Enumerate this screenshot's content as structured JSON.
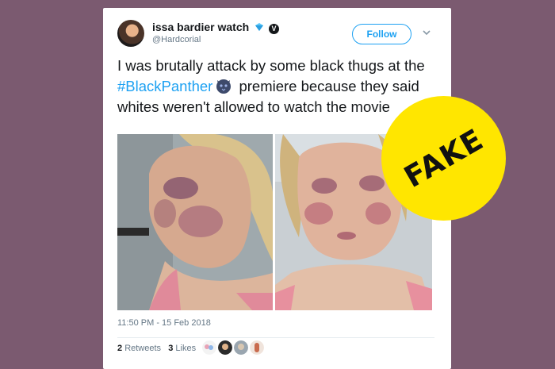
{
  "tweet": {
    "display_name": "issa bardier watch",
    "handle": "@Hardcorial",
    "follow_label": "Follow",
    "text_before_hashtag": "I was brutally attack by some black thugs at the ",
    "hashtag": "#BlackPanther",
    "text_after_hashtag": " premiere because they said whites weren't allowed to watch the movie",
    "timestamp": "11:50 PM - 15 Feb 2018",
    "retweets_count": "2",
    "retweets_label": "Retweets",
    "likes_count": "3",
    "likes_label": "Likes"
  },
  "overlay": {
    "badge_text": "FAKE",
    "badge_color": "#ffe600"
  },
  "colors": {
    "background": "#7b5a70",
    "accent": "#1da1f2",
    "text": "#14171a",
    "muted": "#657786"
  },
  "icons": [
    "verified-icon",
    "v-badge-icon",
    "chevron-down-icon",
    "panther-emoji-icon"
  ]
}
